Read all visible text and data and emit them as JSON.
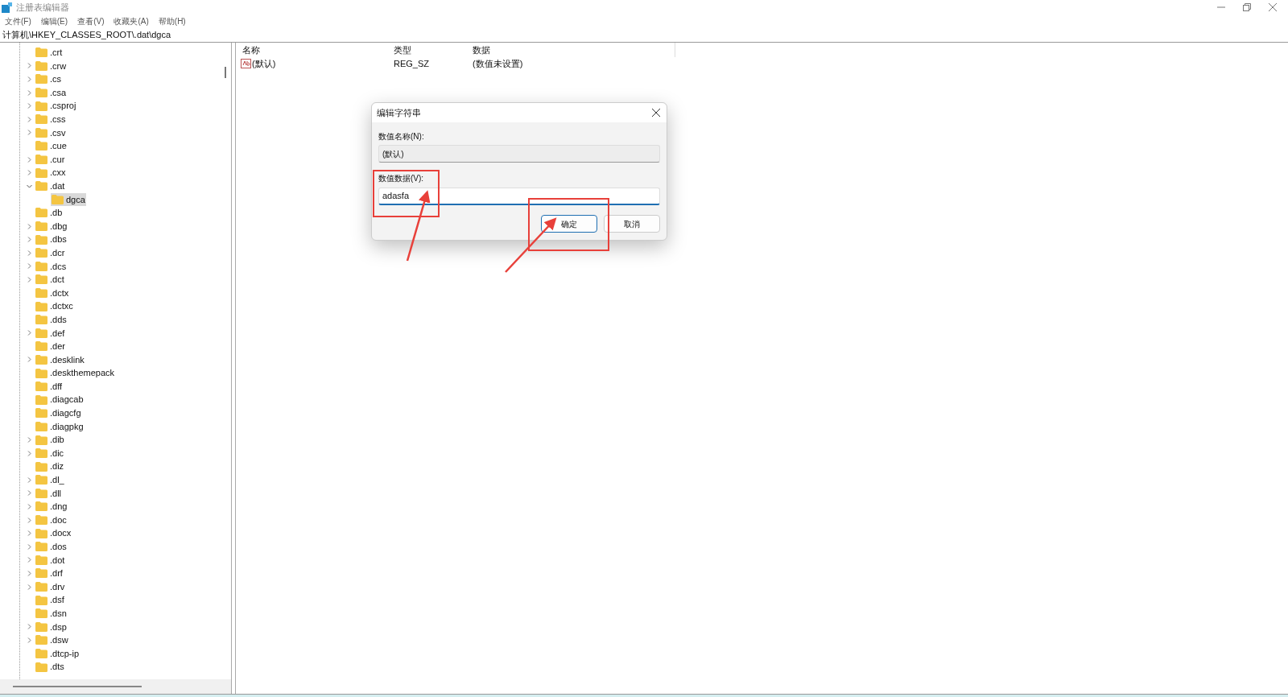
{
  "window": {
    "title": "注册表编辑器"
  },
  "menu": [
    "文件(F)",
    "编辑(E)",
    "查看(V)",
    "收藏夹(A)",
    "帮助(H)"
  ],
  "address": "计算机\\HKEY_CLASSES_ROOT\\.dat\\dgca",
  "tree": [
    {
      "label": ".crt",
      "selected": false
    },
    {
      "label": ".crw",
      "expanded": false,
      "selected": false
    },
    {
      "label": ".cs",
      "expanded": false,
      "selected": false
    },
    {
      "label": ".csa",
      "expanded": false,
      "selected": false
    },
    {
      "label": ".csproj",
      "expanded": false,
      "selected": false
    },
    {
      "label": ".css",
      "expanded": false,
      "selected": false
    },
    {
      "label": ".csv",
      "expanded": false,
      "selected": false
    },
    {
      "label": ".cue",
      "selected": false
    },
    {
      "label": ".cur",
      "expanded": false,
      "selected": false
    },
    {
      "label": ".cxx",
      "expanded": false,
      "selected": false
    },
    {
      "label": ".dat",
      "expanded": true,
      "selected": false,
      "children": [
        {
          "label": "dgca",
          "selected": true
        }
      ]
    },
    {
      "label": ".db",
      "selected": false
    },
    {
      "label": ".dbg",
      "expanded": false,
      "selected": false
    },
    {
      "label": ".dbs",
      "expanded": false,
      "selected": false
    },
    {
      "label": ".dcr",
      "expanded": false,
      "selected": false
    },
    {
      "label": ".dcs",
      "expanded": false,
      "selected": false
    },
    {
      "label": ".dct",
      "expanded": false,
      "selected": false
    },
    {
      "label": ".dctx",
      "selected": false
    },
    {
      "label": ".dctxc",
      "selected": false
    },
    {
      "label": ".dds",
      "selected": false
    },
    {
      "label": ".def",
      "expanded": false,
      "selected": false
    },
    {
      "label": ".der",
      "selected": false
    },
    {
      "label": ".desklink",
      "expanded": false,
      "selected": false
    },
    {
      "label": ".deskthemepack",
      "selected": false
    },
    {
      "label": ".dff",
      "selected": false
    },
    {
      "label": ".diagcab",
      "selected": false
    },
    {
      "label": ".diagcfg",
      "selected": false
    },
    {
      "label": ".diagpkg",
      "selected": false
    },
    {
      "label": ".dib",
      "expanded": false,
      "selected": false
    },
    {
      "label": ".dic",
      "expanded": false,
      "selected": false
    },
    {
      "label": ".diz",
      "selected": false
    },
    {
      "label": ".dl_",
      "expanded": false,
      "selected": false
    },
    {
      "label": ".dll",
      "expanded": false,
      "selected": false
    },
    {
      "label": ".dng",
      "expanded": false,
      "selected": false
    },
    {
      "label": ".doc",
      "expanded": false,
      "selected": false
    },
    {
      "label": ".docx",
      "expanded": false,
      "selected": false
    },
    {
      "label": ".dos",
      "expanded": false,
      "selected": false
    },
    {
      "label": ".dot",
      "expanded": false,
      "selected": false
    },
    {
      "label": ".drf",
      "expanded": false,
      "selected": false
    },
    {
      "label": ".drv",
      "expanded": false,
      "selected": false
    },
    {
      "label": ".dsf",
      "selected": false
    },
    {
      "label": ".dsn",
      "selected": false
    },
    {
      "label": ".dsp",
      "expanded": false,
      "selected": false
    },
    {
      "label": ".dsw",
      "expanded": false,
      "selected": false
    },
    {
      "label": ".dtcp-ip",
      "selected": false
    },
    {
      "label": ".dts",
      "selected": false
    }
  ],
  "table": {
    "columns": [
      "名称",
      "类型",
      "数据"
    ],
    "rows": [
      {
        "name": "(默认)",
        "type": "REG_SZ",
        "data": "(数值未设置)"
      }
    ]
  },
  "dialog": {
    "title": "编辑字符串",
    "name_label": "数值名称(N):",
    "name_value": "(默认)",
    "data_label": "数值数据(V):",
    "data_value": "adasfa",
    "buttons": [
      {
        "label": "确定",
        "default": true
      },
      {
        "label": "取消",
        "default": false
      }
    ]
  }
}
